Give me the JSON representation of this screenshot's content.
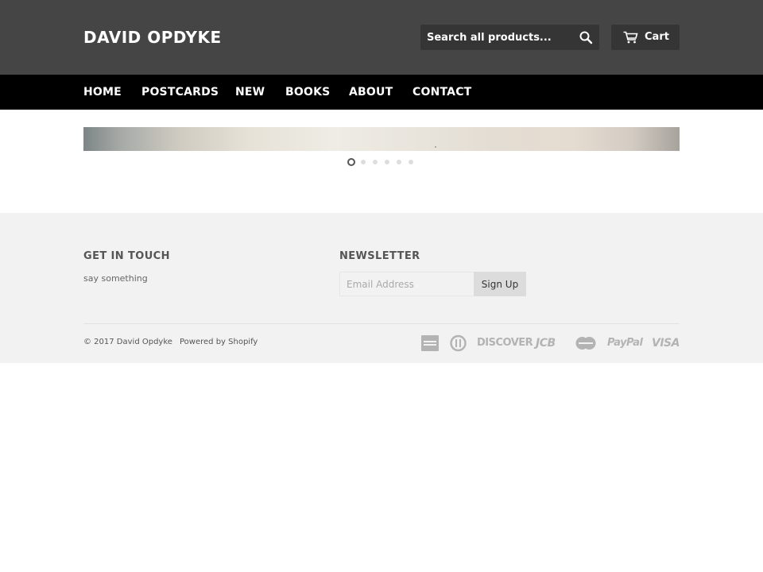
{
  "header": {
    "site_title": "DAVID OPDYKE",
    "search_placeholder": "Search all products...",
    "cart_label": "Cart"
  },
  "nav": {
    "items": [
      {
        "label": "HOME"
      },
      {
        "label": "POSTCARDS"
      },
      {
        "label": "NEW"
      },
      {
        "label": "BOOKS"
      },
      {
        "label": "ABOUT"
      },
      {
        "label": "CONTACT"
      }
    ]
  },
  "slideshow": {
    "slide_count": 6,
    "active_index": 0
  },
  "footer": {
    "contact_heading": "GET IN TOUCH",
    "contact_text": "say something",
    "newsletter_heading": "NEWSLETTER",
    "email_placeholder": "Email Address",
    "signup_label": "Sign Up",
    "copyright": "© 2017 David Opdyke",
    "powered_by": "Powered by Shopify",
    "payment_icons": [
      "american-express-icon",
      "diners-club-icon",
      "discover-icon",
      "jcb-icon",
      "master-icon",
      "paypal-icon",
      "visa-icon"
    ],
    "payment_labels": {
      "discover": "DISCOVER",
      "jcb": "JCB",
      "paypal": "PayPal",
      "visa": "VISA"
    }
  },
  "colors": {
    "header_bg": "#454545",
    "nav_bg": "#000000",
    "footer_bg": "#f2f2f2"
  }
}
